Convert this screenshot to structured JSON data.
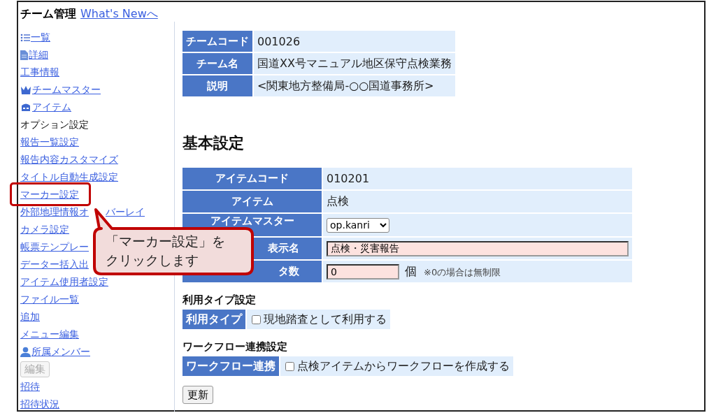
{
  "header": {
    "title": "チーム管理",
    "link": "What's Newへ"
  },
  "sidebar": {
    "items": [
      {
        "kind": "list",
        "label": "一覧",
        "highlighted": false
      },
      {
        "kind": "document",
        "label": "詳細",
        "highlighted": false
      },
      {
        "kind": "link",
        "label": "工事情報",
        "highlighted": false
      },
      {
        "kind": "crown",
        "label": "チームマスター",
        "highlighted": false
      },
      {
        "kind": "bag",
        "label": "アイテム",
        "highlighted": false
      },
      {
        "kind": "text",
        "label": "オプション設定",
        "highlighted": false
      },
      {
        "kind": "link",
        "label": "報告一覧設定",
        "highlighted": false
      },
      {
        "kind": "link",
        "label": "報告内容カスタマイズ",
        "highlighted": false
      },
      {
        "kind": "link",
        "label": "タイトル自動生成設定",
        "highlighted": false
      },
      {
        "kind": "link",
        "label": "マーカー設定",
        "highlighted": true
      },
      {
        "kind": "split-link",
        "label_parts": [
          "外部地理情報オ",
          "バーレイ"
        ],
        "highlighted": false
      },
      {
        "kind": "link",
        "label": "カメラ設定",
        "highlighted": false
      },
      {
        "kind": "link",
        "label": "帳票テンプレー",
        "highlighted": false
      },
      {
        "kind": "link",
        "label": "データー括入出",
        "highlighted": false
      },
      {
        "kind": "link",
        "label": "アイテム使用者設定",
        "highlighted": false
      },
      {
        "kind": "link",
        "label": "ファイル一覧",
        "highlighted": false
      },
      {
        "kind": "link",
        "label": "追加",
        "highlighted": false
      },
      {
        "kind": "link",
        "label": "メニュー編集",
        "highlighted": false
      },
      {
        "kind": "person",
        "label": "所属メンバー",
        "highlighted": false
      },
      {
        "kind": "button",
        "label": "編集",
        "disabled": true,
        "highlighted": false
      },
      {
        "kind": "link",
        "label": "招待",
        "highlighted": false
      },
      {
        "kind": "link",
        "label": "招待状況",
        "highlighted": false
      }
    ]
  },
  "team_table": {
    "rows": [
      {
        "label": "チームコード",
        "value": "001026"
      },
      {
        "label": "チーム名",
        "value": "国道XX号マニュアル地区保守点検業務"
      },
      {
        "label": "説明",
        "value": "<関東地方整備局-○○国道事務所>"
      }
    ]
  },
  "basic_settings": {
    "heading": "基本設定",
    "rows": [
      {
        "kind": "text",
        "label": "アイテムコード",
        "value": "010201"
      },
      {
        "kind": "text",
        "label": "アイテム",
        "value": "点検"
      },
      {
        "kind": "select",
        "label": "アイテムマスター",
        "value": "op.kanri"
      },
      {
        "kind": "input",
        "label": "表示名",
        "value": "点検・災害報告"
      },
      {
        "kind": "count",
        "label": "タ数",
        "value": "0",
        "unit": "個",
        "note": "※0の場合は無制限"
      }
    ]
  },
  "sections": [
    {
      "heading": "利用タイプ設定",
      "label": "利用タイプ",
      "option": "現地踏査として利用する",
      "checked": false
    },
    {
      "heading": "ワークフロー連携設定",
      "label": "ワークフロー連携",
      "option": "点検アイテムからワークフローを作成する",
      "checked": false
    }
  ],
  "update_button": "更新",
  "callout": {
    "lines": [
      "「マーカー設定」を",
      "クリックします"
    ]
  }
}
